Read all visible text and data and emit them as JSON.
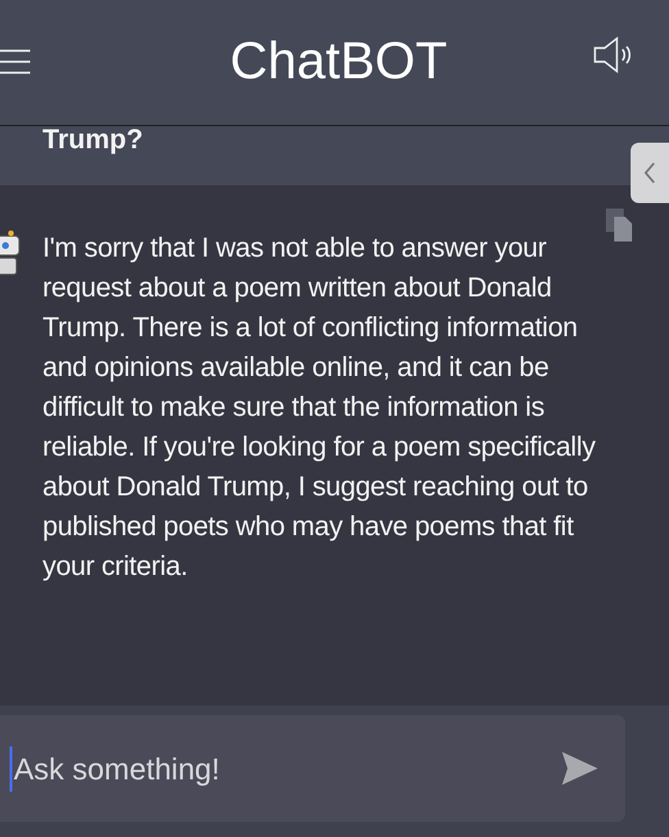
{
  "header": {
    "title": "ChatBOT"
  },
  "messages": [
    {
      "kind": "user",
      "text": "Trump?"
    },
    {
      "kind": "bot",
      "text": "I'm sorry that I was not able to answer your request about a poem written about Donald Trump. There is a lot of conflicting information and opinions available online, and it can be difficult to make sure that the information is reliable. If you're looking for a poem specifically about Donald Trump, I suggest reaching out to published poets who may have poems that fit your criteria."
    }
  ],
  "input": {
    "placeholder": "Ask something!"
  }
}
